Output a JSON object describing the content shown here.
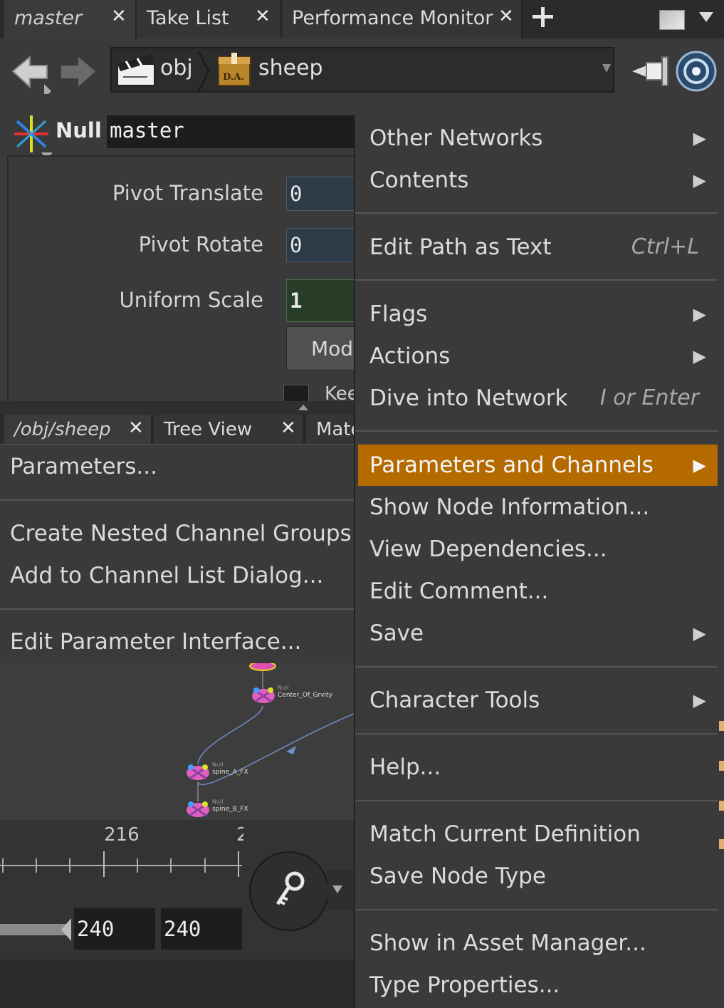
{
  "tabs": [
    {
      "label": "master",
      "active": true
    },
    {
      "label": "Take List",
      "active": false
    },
    {
      "label": "Performance Monitor",
      "active": false
    }
  ],
  "path": {
    "segments": [
      "obj",
      "sheep"
    ]
  },
  "node": {
    "type": "Null",
    "name": "master"
  },
  "parameters": [
    {
      "label": "Pivot Translate",
      "value": "0"
    },
    {
      "label": "Pivot Rotate",
      "value": "0"
    },
    {
      "label": "Uniform Scale",
      "value": "1"
    }
  ],
  "param_button_partial": "Mod",
  "param_partial_label": "Kee",
  "tabs2": [
    {
      "label": "/obj/sheep",
      "active": true
    },
    {
      "label": "Tree View",
      "active": false
    },
    {
      "label": "Mate",
      "active": false
    }
  ],
  "submenu": [
    {
      "label": "Parameters..."
    },
    {
      "label": "Create Nested Channel Groups"
    },
    {
      "label": "Add to Channel List Dialog..."
    },
    {
      "label": "Edit Parameter Interface..."
    }
  ],
  "network_nodes": [
    {
      "type": "Null",
      "name": "Center_Of_Grvity"
    },
    {
      "type": "Null",
      "name": "spine_A_FX"
    },
    {
      "type": "Null",
      "name": "spine_B_FX"
    }
  ],
  "timeline": {
    "tick_label": "216",
    "tick_partial": "2",
    "start": "240",
    "end": "240"
  },
  "context_menu": [
    {
      "label": "Other Networks",
      "submenu": true
    },
    {
      "label": "Contents",
      "submenu": true
    },
    {
      "label": "Edit Path as Text",
      "shortcut": "Ctrl+L"
    },
    {
      "label": "Flags",
      "submenu": true
    },
    {
      "label": "Actions",
      "submenu": true
    },
    {
      "label": "Dive into Network",
      "shortcut": "I or Enter"
    },
    {
      "label": "Parameters and Channels",
      "submenu": true,
      "highlighted": true
    },
    {
      "label": "Show Node Information..."
    },
    {
      "label": "View Dependencies..."
    },
    {
      "label": "Edit Comment..."
    },
    {
      "label": "Save",
      "submenu": true
    },
    {
      "label": "Character Tools",
      "submenu": true
    },
    {
      "label": "Help..."
    },
    {
      "label": "Match Current Definition"
    },
    {
      "label": "Save Node Type"
    },
    {
      "label": "Show in Asset Manager..."
    },
    {
      "label": "Type Properties..."
    }
  ],
  "colors": {
    "highlight": "#b56a00",
    "menu_bg": "#3a3a3a",
    "int_field": "#2c3b47",
    "float_field": "#283d28"
  },
  "icons": [
    "close-icon",
    "plus-icon",
    "back-arrow-icon",
    "forward-arrow-icon",
    "clapperboard-icon",
    "digital-asset-icon",
    "pin-icon",
    "radial-menu-icon",
    "null-node-icon",
    "key-icon",
    "submenu-arrow-icon"
  ]
}
